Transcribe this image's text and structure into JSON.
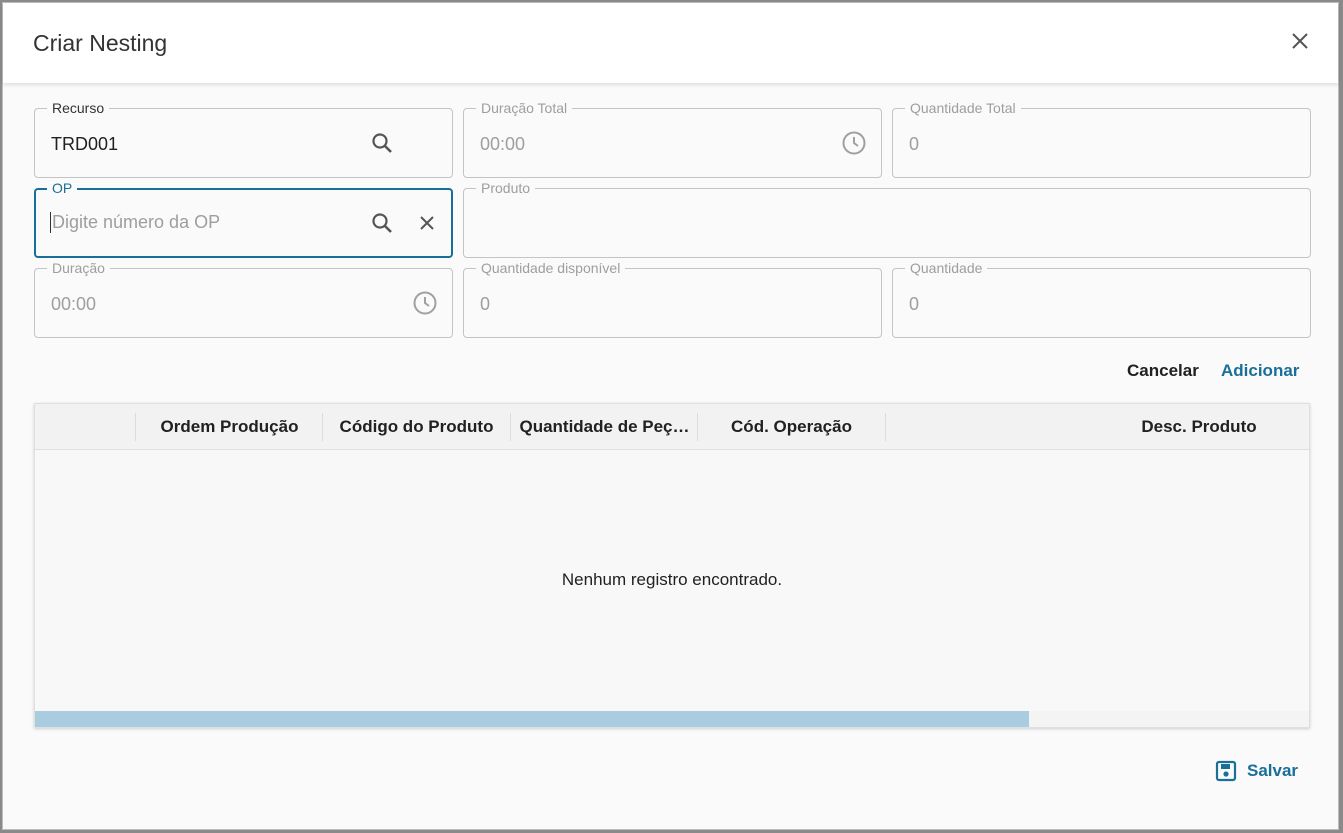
{
  "dialog": {
    "title": "Criar Nesting",
    "close_icon": "close-icon"
  },
  "form": {
    "recurso": {
      "label": "Recurso",
      "value": "TRD001"
    },
    "duracao_total": {
      "label": "Duração Total",
      "value": "00:00"
    },
    "quantidade_total": {
      "label": "Quantidade Total",
      "value": "0"
    },
    "op": {
      "label": "OP",
      "placeholder": "Digite número da OP",
      "value": ""
    },
    "produto": {
      "label": "Produto",
      "value": ""
    },
    "duracao": {
      "label": "Duração",
      "value": "00:00"
    },
    "quantidade_disponivel": {
      "label": "Quantidade disponível",
      "value": "0"
    },
    "quantidade": {
      "label": "Quantidade",
      "value": "0"
    }
  },
  "actions": {
    "cancel_label": "Cancelar",
    "add_label": "Adicionar",
    "save_label": "Salvar"
  },
  "grid": {
    "columns": [
      "Ordem Produção",
      "Código do Produto",
      "Quantidade de Peç…",
      "Cód. Operação",
      "Desc. Produto"
    ],
    "empty_message": "Nenhum registro encontrado.",
    "scroll_fraction": 0.78
  },
  "colors": {
    "accent": "#1a6f99",
    "scrollbar": "#a9cce0"
  }
}
